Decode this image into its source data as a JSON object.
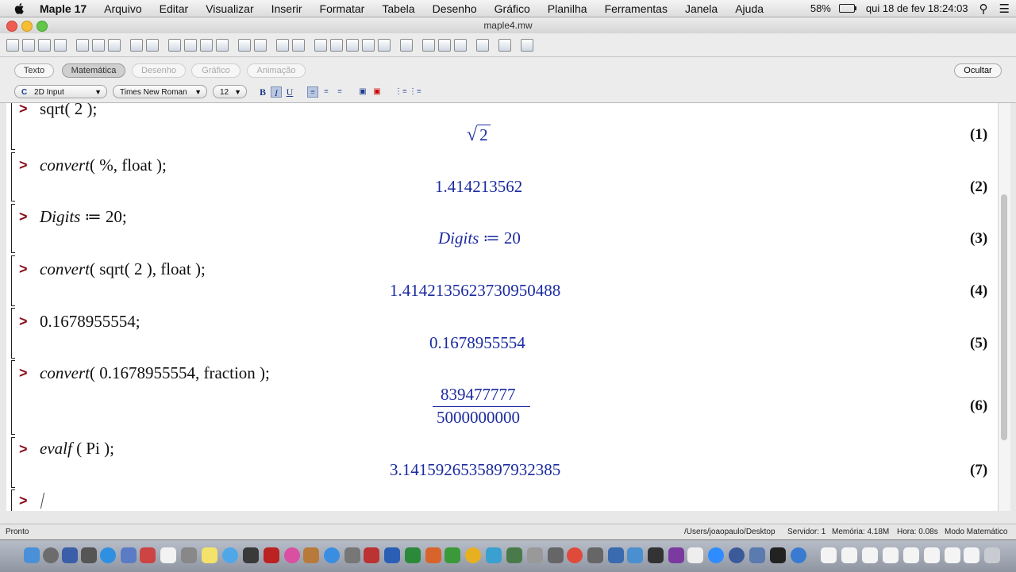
{
  "menubar": {
    "app_name": "Maple 17",
    "items": [
      "Arquivo",
      "Editar",
      "Visualizar",
      "Inserir",
      "Formatar",
      "Tabela",
      "Desenho",
      "Gráfico",
      "Planilha",
      "Ferramentas",
      "Janela",
      "Ajuda"
    ],
    "battery": "58%",
    "clock": "qui 18 de fev  18:24:03"
  },
  "window": {
    "title": "maple4.mw"
  },
  "modes": {
    "items": [
      "Texto",
      "Matemática",
      "Desenho",
      "Gráfico",
      "Animação"
    ],
    "active": "Matemática",
    "hide_label": "Ocultar"
  },
  "format": {
    "input_mode": "2D Input",
    "font": "Times New Roman",
    "size": "12"
  },
  "worksheet": {
    "prompt": ">",
    "sqrt_symbol": "√",
    "rows": [
      {
        "input_pre": "sqrt( 2 );",
        "input_ital": "",
        "input_post": "",
        "output": "2",
        "label": "(1)"
      },
      {
        "input_pre": "",
        "input_ital": "convert",
        "input_post": "( %, float );",
        "output": "1.414213562",
        "label": "(2)"
      },
      {
        "input_pre": "",
        "input_ital": "Digits",
        "input_post": " ≔ 20;",
        "output_ital": "Digits",
        "output": " ≔ 20",
        "label": "(3)"
      },
      {
        "input_pre": "",
        "input_ital": "convert",
        "input_post": "( sqrt( 2 ), float );",
        "output": "1.4142135623730950488",
        "label": "(4)"
      },
      {
        "input_pre": "0.1678955554;",
        "input_ital": "",
        "input_post": "",
        "output": "0.1678955554",
        "label": "(5)"
      },
      {
        "input_pre": "",
        "input_ital": "convert",
        "input_post": "( 0.1678955554, fraction );",
        "numerator": "839477777",
        "denominator": "5000000000",
        "label": "(6)"
      },
      {
        "input_pre": "",
        "input_ital": "evalf",
        "input_post": " ( Pi );",
        "output": "3.1415926535897932385",
        "label": "(7)"
      }
    ]
  },
  "status": {
    "left": "Pronto",
    "path": "/Users/joaopaulo/Desktop",
    "server": "Servidor: 1",
    "memory": "Memória: 4.18M",
    "time": "Hora: 0.08s",
    "mode": "Modo Matemático"
  },
  "colors": {
    "prompt": "#8b0d18",
    "output": "#1b2aa0"
  }
}
